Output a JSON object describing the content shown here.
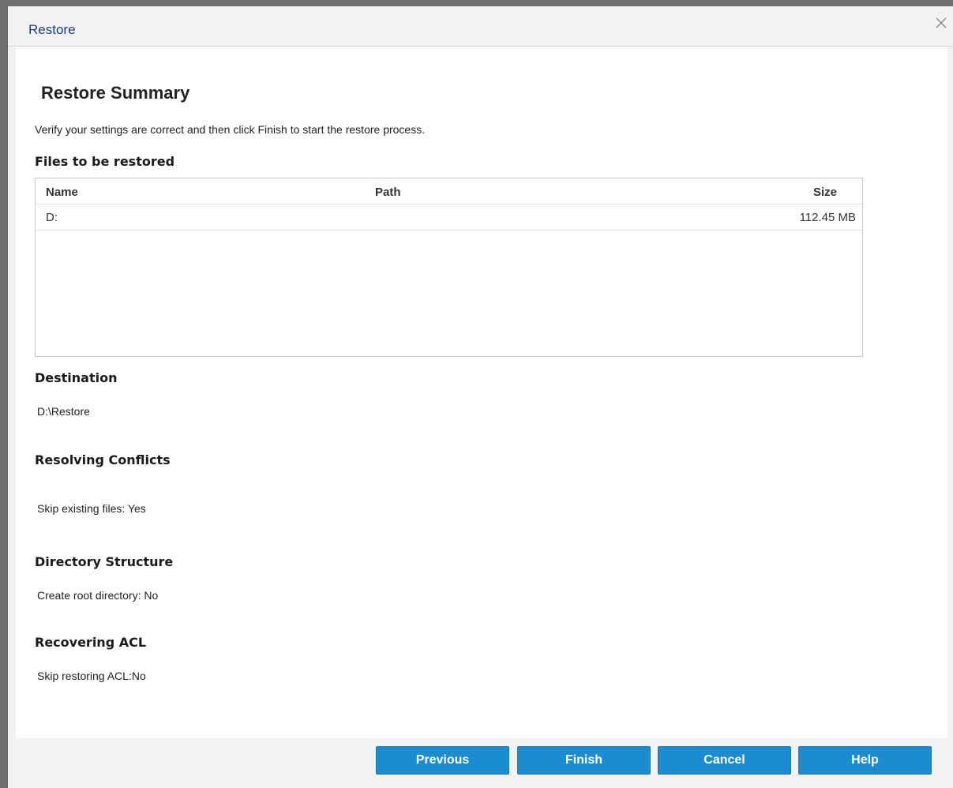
{
  "dialog": {
    "title": "Restore",
    "close_icon": "close-icon"
  },
  "summary": {
    "heading": "Restore Summary",
    "intro": "Verify your settings are correct and then click Finish to start the restore process."
  },
  "files": {
    "heading": "Files to be restored",
    "columns": [
      "Name",
      "Path",
      "Size"
    ],
    "rows": [
      {
        "name": "D:",
        "path": "",
        "size": "112.45 MB"
      }
    ]
  },
  "destination": {
    "heading": "Destination",
    "value": "D:\\Restore"
  },
  "conflicts": {
    "heading": "Resolving Conflicts",
    "value": "Skip existing files: Yes"
  },
  "directory": {
    "heading": "Directory Structure",
    "value": "Create root directory: No"
  },
  "acl": {
    "heading": "Recovering ACL",
    "value": "Skip restoring ACL:No"
  },
  "buttons": {
    "previous": "Previous",
    "finish": "Finish",
    "cancel": "Cancel",
    "help": "Help"
  },
  "colors": {
    "button": "#1a8ccf",
    "title": "#1f3f7a"
  }
}
